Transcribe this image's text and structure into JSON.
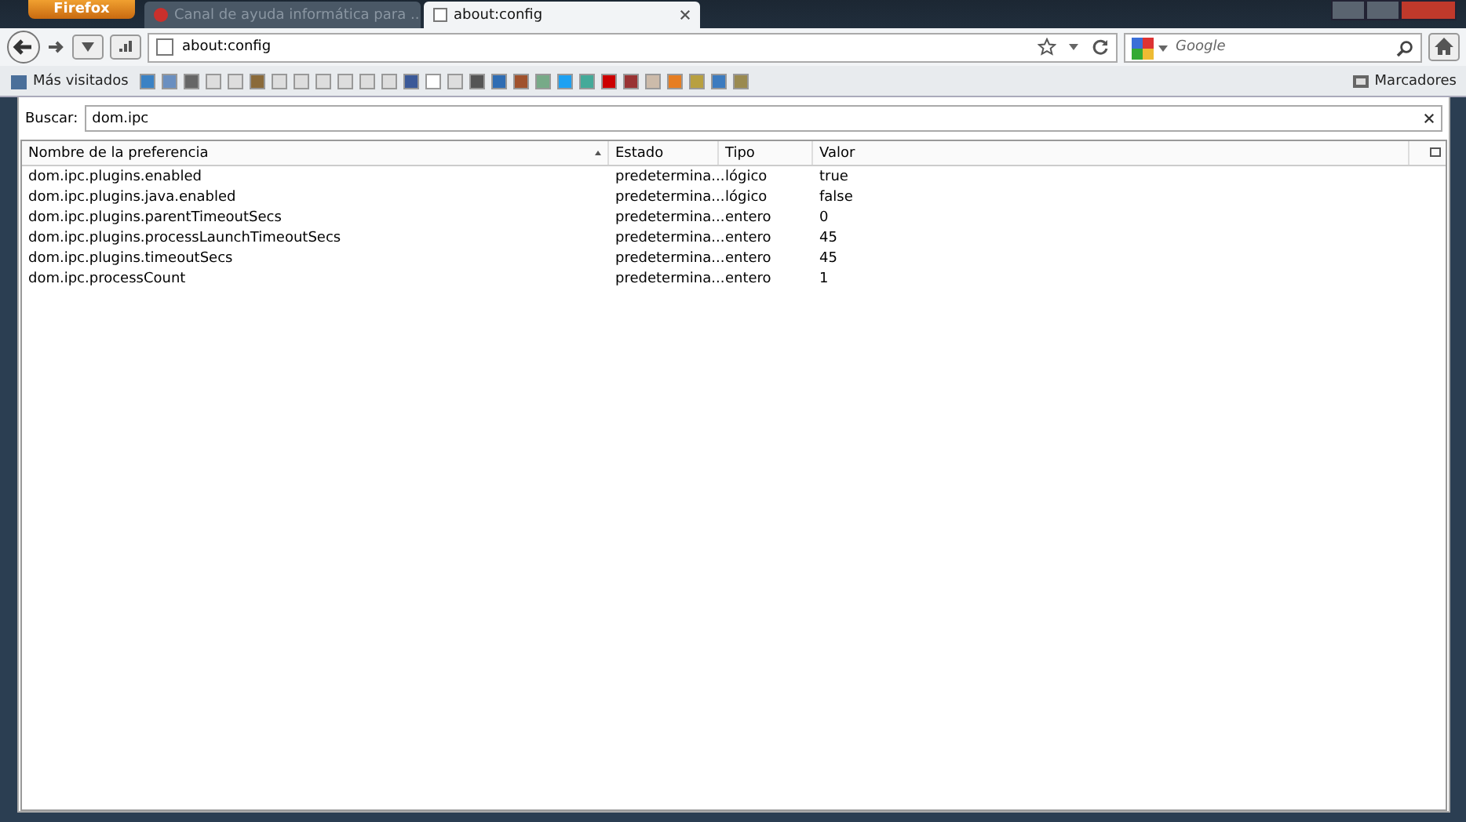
{
  "app_button": {
    "label": "Firefox"
  },
  "tabs": [
    {
      "title": "Canal de ayuda informática para ...",
      "selected": false
    },
    {
      "title": "about:config",
      "selected": true
    }
  ],
  "address_bar": {
    "value": "about:config"
  },
  "search_engine": {
    "placeholder": "Google"
  },
  "bookmarks_bar": {
    "most_visited": "Más visitados",
    "bookmarks_menu": "Marcadores"
  },
  "filter": {
    "label": "Buscar:",
    "value": "dom.ipc"
  },
  "table": {
    "columns": [
      "Nombre de la preferencia",
      "Estado",
      "Tipo",
      "Valor"
    ],
    "rows": [
      [
        "dom.ipc.plugins.enabled",
        "predetermina...",
        "lógico",
        "true"
      ],
      [
        "dom.ipc.plugins.java.enabled",
        "predetermina...",
        "lógico",
        "false"
      ],
      [
        "dom.ipc.plugins.parentTimeoutSecs",
        "predetermina...",
        "entero",
        "0"
      ],
      [
        "dom.ipc.plugins.processLaunchTimeoutSecs",
        "predetermina...",
        "entero",
        "45"
      ],
      [
        "dom.ipc.plugins.timeoutSecs",
        "predetermina...",
        "entero",
        "45"
      ],
      [
        "dom.ipc.processCount",
        "predetermina...",
        "entero",
        "1"
      ]
    ]
  }
}
